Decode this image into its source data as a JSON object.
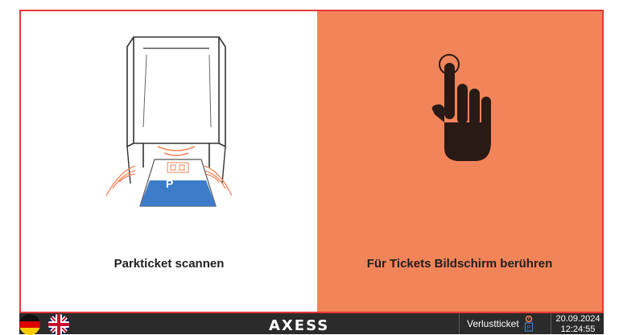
{
  "left_panel": {
    "label": "Parkticket scannen",
    "ticket_letter": "P",
    "background": "#ffffff"
  },
  "right_panel": {
    "label": "Für Tickets Bildschirm berühren",
    "background": "#f2845a",
    "icon": "touch-hand-icon"
  },
  "frame_color": "#e53935",
  "footer": {
    "background": "#2b2b2b",
    "languages": [
      {
        "code": "de",
        "icon": "germany-flag-icon"
      },
      {
        "code": "en",
        "icon": "uk-flag-icon"
      }
    ],
    "logo": "AXESS",
    "lost_ticket_label": "Verlustticket",
    "date": "20.09.2024",
    "time": "12:24:55"
  }
}
